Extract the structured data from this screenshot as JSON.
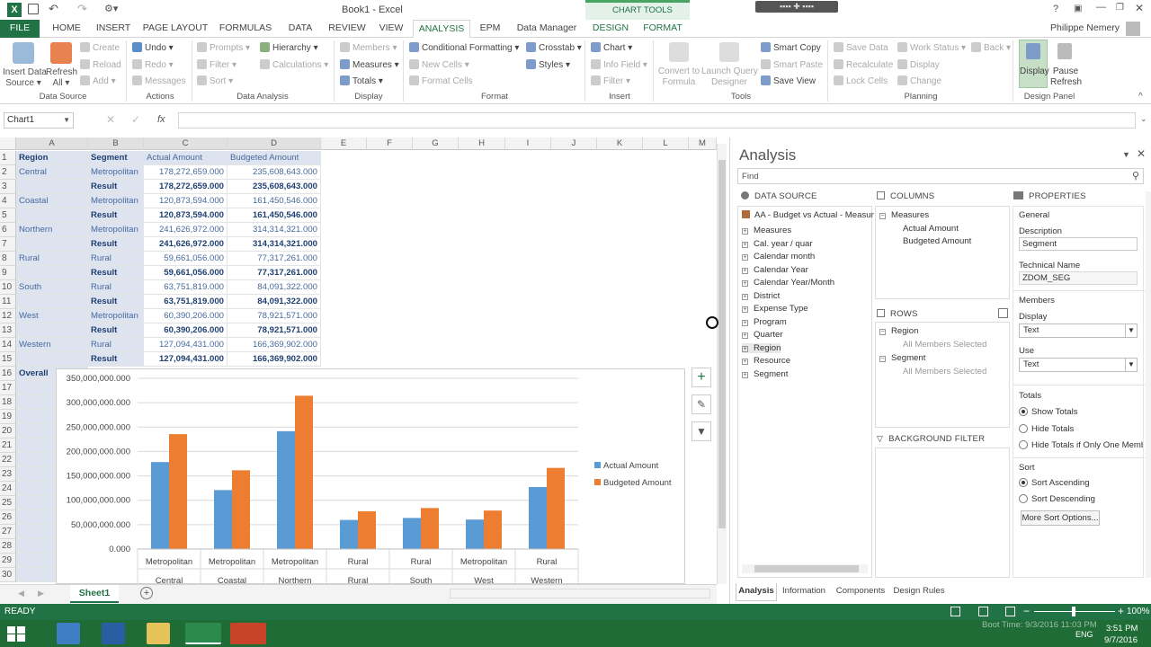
{
  "window": {
    "title": "Book1 - Excel",
    "user": "Philippe Nemery",
    "chart_tools": "CHART TOOLS"
  },
  "tabs": [
    "FILE",
    "HOME",
    "INSERT",
    "PAGE LAYOUT",
    "FORMULAS",
    "DATA",
    "REVIEW",
    "VIEW",
    "ANALYSIS",
    "EPM",
    "Data Manager",
    "DESIGN",
    "FORMAT"
  ],
  "ribbon": {
    "data_source": {
      "insert": "Insert Data",
      "source": "Source",
      "refresh": "Refresh",
      "all": "All",
      "create": "Create",
      "reload": "Reload",
      "add": "Add",
      "label": "Data Source"
    },
    "actions": {
      "undo": "Undo",
      "redo": "Redo",
      "messages": "Messages",
      "label": "Actions"
    },
    "data_analysis": {
      "prompts": "Prompts",
      "filter": "Filter",
      "sort": "Sort",
      "hierarchy": "Hierarchy",
      "calculations": "Calculations",
      "label": "Data Analysis"
    },
    "display": {
      "members": "Members",
      "measures": "Measures",
      "totals": "Totals",
      "label": "Display"
    },
    "format": {
      "conditional": "Conditional Formatting",
      "new_cells": "New Cells",
      "format_cells": "Format Cells",
      "crosstab": "Crosstab",
      "styles": "Styles",
      "label": "Format"
    },
    "insert": {
      "chart": "Chart",
      "info_field": "Info Field",
      "filter": "Filter",
      "label": "Insert"
    },
    "tools": {
      "convert": "Convert to",
      "formula": "Formula",
      "launch": "Launch Query",
      "designer": "Designer",
      "smart_copy": "Smart Copy",
      "smart_paste": "Smart Paste",
      "save_view": "Save View",
      "label": "Tools"
    },
    "planning": {
      "save_data": "Save Data",
      "recalculate": "Recalculate",
      "lock_cells": "Lock Cells",
      "work_status": "Work Status",
      "display": "Display",
      "change": "Change",
      "back": "Back",
      "label": "Planning"
    },
    "design_panel": {
      "display": "Display",
      "pause": "Pause",
      "refresh": "Refresh",
      "label": "Design Panel"
    }
  },
  "formula_bar": {
    "name_box": "Chart1",
    "fx": "fx",
    "value": ""
  },
  "columns": [
    "A",
    "B",
    "C",
    "D",
    "E",
    "F",
    "G",
    "H",
    "I",
    "J",
    "K",
    "L",
    "M"
  ],
  "rows": [
    "1",
    "2",
    "3",
    "4",
    "5",
    "6",
    "7",
    "8",
    "9",
    "10",
    "11",
    "12",
    "13",
    "14",
    "15",
    "16",
    "17",
    "18",
    "19",
    "20",
    "21",
    "22",
    "23",
    "24",
    "25",
    "26",
    "27",
    "28",
    "29",
    "30"
  ],
  "table": {
    "header": [
      "Region",
      "Segment",
      "Actual Amount",
      "Budgeted Amount"
    ],
    "data": [
      [
        "Central",
        "Metropolitan",
        "178,272,659.000",
        "235,608,643.000"
      ],
      [
        "",
        "Result",
        "178,272,659.000",
        "235,608,643.000"
      ],
      [
        "Coastal",
        "Metropolitan",
        "120,873,594.000",
        "161,450,546.000"
      ],
      [
        "",
        "Result",
        "120,873,594.000",
        "161,450,546.000"
      ],
      [
        "Northern",
        "Metropolitan",
        "241,626,972.000",
        "314,314,321.000"
      ],
      [
        "",
        "Result",
        "241,626,972.000",
        "314,314,321.000"
      ],
      [
        "Rural",
        "Rural",
        "59,661,056.000",
        "77,317,261.000"
      ],
      [
        "",
        "Result",
        "59,661,056.000",
        "77,317,261.000"
      ],
      [
        "South",
        "Rural",
        "63,751,819.000",
        "84,091,322.000"
      ],
      [
        "",
        "Result",
        "63,751,819.000",
        "84,091,322.000"
      ],
      [
        "West",
        "Metropolitan",
        "60,390,206.000",
        "78,921,571.000"
      ],
      [
        "",
        "Result",
        "60,390,206.000",
        "78,921,571.000"
      ],
      [
        "Western",
        "Rural",
        "127,094,431.000",
        "166,369,902.000"
      ],
      [
        "",
        "Result",
        "127,094,431.000",
        "166,369,902.000"
      ],
      [
        "Overall",
        "",
        "",
        ""
      ]
    ]
  },
  "chart_data": {
    "type": "bar",
    "categories": [
      [
        "Metropolitan",
        "Central"
      ],
      [
        "Metropolitan",
        "Coastal"
      ],
      [
        "Metropolitan",
        "Northern"
      ],
      [
        "Rural",
        "Rural"
      ],
      [
        "Rural",
        "South"
      ],
      [
        "Metropolitan",
        "West"
      ],
      [
        "Rural",
        "Western"
      ]
    ],
    "series": [
      {
        "name": "Actual Amount",
        "color": "#5b9bd5",
        "values": [
          178272659,
          120873594,
          241626972,
          59661056,
          63751819,
          60390206,
          127094431
        ]
      },
      {
        "name": "Budgeted Amount",
        "color": "#ed7d31",
        "values": [
          235608643,
          161450546,
          314314321,
          77317261,
          84091322,
          78921571,
          166369902
        ]
      }
    ],
    "ylim": [
      0,
      350000000
    ],
    "yticks": [
      "0.000",
      "50,000,000.000",
      "100,000,000.000",
      "150,000,000.000",
      "200,000,000.000",
      "250,000,000.000",
      "300,000,000.000",
      "350,000,000.000"
    ],
    "legend": "right",
    "grid": true
  },
  "sheet": {
    "tab": "Sheet1"
  },
  "pane": {
    "title": "Analysis",
    "find_placeholder": "Find",
    "data_source_hdr": "DATA SOURCE",
    "columns_hdr": "COLUMNS",
    "properties_hdr": "PROPERTIES",
    "rows_hdr": "ROWS",
    "bg_filter_hdr": "BACKGROUND FILTER",
    "source_name": "AA - Budget vs Actual - Measur",
    "tree": [
      "Measures",
      "Cal. year / quar",
      "Calendar month",
      "Calendar Year",
      "Calendar Year/Month",
      "District",
      "Expense Type",
      "Program",
      "Quarter",
      "Region",
      "Resource",
      "Segment"
    ],
    "columns_items": {
      "group": "Measures",
      "items": [
        "Actual Amount",
        "Budgeted Amount"
      ]
    },
    "rows_items": [
      {
        "name": "Region",
        "sub": "All Members Selected"
      },
      {
        "name": "Segment",
        "sub": "All Members Selected"
      }
    ],
    "props": {
      "general": "General",
      "description_lbl": "Description",
      "description": "Segment",
      "technical_lbl": "Technical Name",
      "technical": "ZDOM_SEG",
      "members": "Members",
      "display_lbl": "Display",
      "display": "Text",
      "use_lbl": "Use",
      "use": "Text",
      "totals": "Totals",
      "show_totals": "Show Totals",
      "hide_totals": "Hide Totals",
      "hide_totals_one": "Hide Totals if Only One Memb",
      "sort": "Sort",
      "sort_asc": "Sort Ascending",
      "sort_desc": "Sort Descending",
      "more_sort": "More Sort Options..."
    },
    "bottom_tabs": [
      "Analysis",
      "Information",
      "Components",
      "Design Rules"
    ]
  },
  "status": {
    "ready": "READY",
    "zoom": "100%"
  },
  "taskbar": {
    "time": "3:51 PM",
    "date": "9/7/2016",
    "lang": "ENG",
    "overlay": "Boot Time: 9/3/2016 11:03 PM"
  }
}
